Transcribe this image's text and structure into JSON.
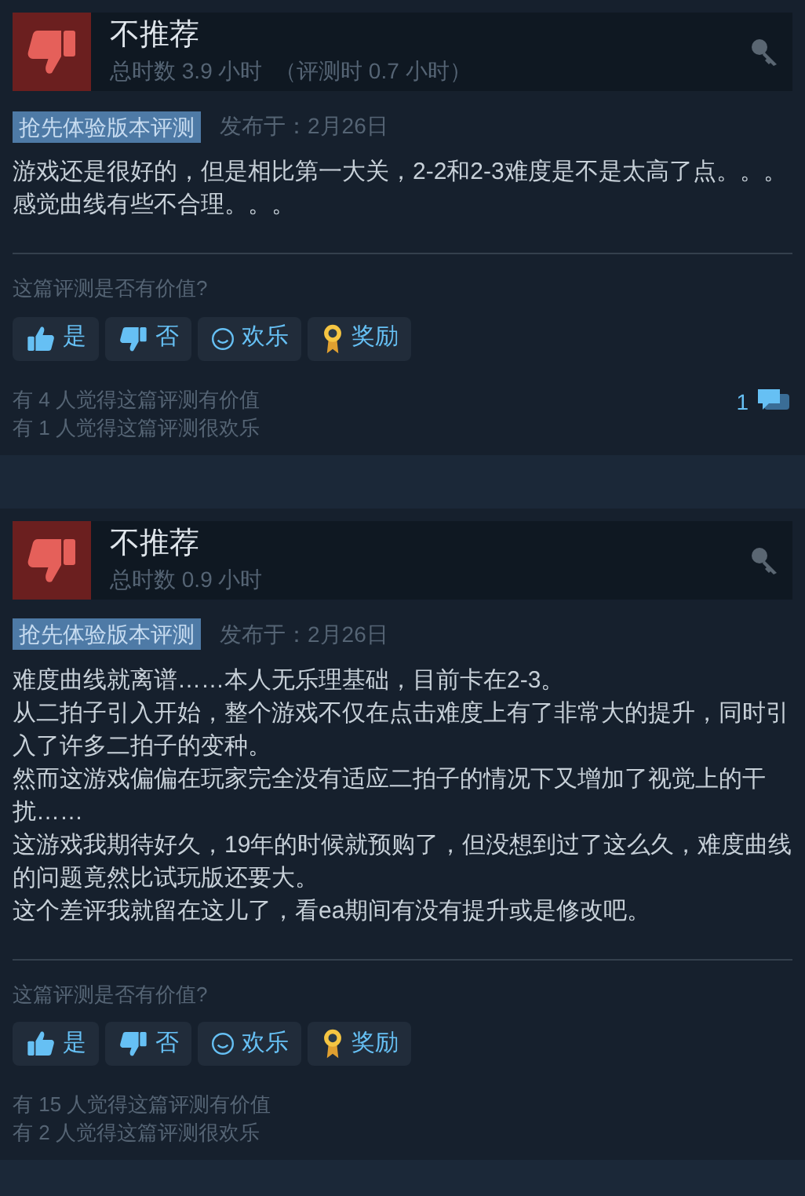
{
  "reviews": [
    {
      "recommended": false,
      "verdict": "不推荐",
      "hours": "总时数 3.9 小时  （评测时 0.7 小时）",
      "badge": "抢先体验版本评测",
      "posted": "发布于：2月26日",
      "paragraphs": [
        "游戏还是很好的，但是相比第一大关，2-2和2-3难度是不是太高了点。。。感觉曲线有些不合理。。。"
      ],
      "question": "这篇评测是否有价值?",
      "buttons": [
        {
          "kind": "yes",
          "label": "是"
        },
        {
          "kind": "no",
          "label": "否"
        },
        {
          "kind": "funny",
          "label": "欢乐"
        },
        {
          "kind": "award",
          "label": "奖励"
        }
      ],
      "stats": [
        "有 4 人觉得这篇评测有价值",
        "有 1 人觉得这篇评测很欢乐"
      ],
      "comments": "1"
    },
    {
      "recommended": false,
      "verdict": "不推荐",
      "hours": "总时数 0.9 小时",
      "badge": "抢先体验版本评测",
      "posted": "发布于：2月26日",
      "paragraphs": [
        "难度曲线就离谱……本人无乐理基础，目前卡在2-3。",
        "从二拍子引入开始，整个游戏不仅在点击难度上有了非常大的提升，同时引入了许多二拍子的变种。",
        "然而这游戏偏偏在玩家完全没有适应二拍子的情况下又增加了视觉上的干扰……",
        "这游戏我期待好久，19年的时候就预购了，但没想到过了这么久，难度曲线的问题竟然比试玩版还要大。",
        "这个差评我就留在这儿了，看ea期间有没有提升或是修改吧。"
      ],
      "question": "这篇评测是否有价值?",
      "buttons": [
        {
          "kind": "yes",
          "label": "是"
        },
        {
          "kind": "no",
          "label": "否"
        },
        {
          "kind": "funny",
          "label": "欢乐"
        },
        {
          "kind": "award",
          "label": "奖励"
        }
      ],
      "stats": [
        "有 15 人觉得这篇评测有价值",
        "有 2 人觉得这篇评测很欢乐"
      ]
    }
  ]
}
